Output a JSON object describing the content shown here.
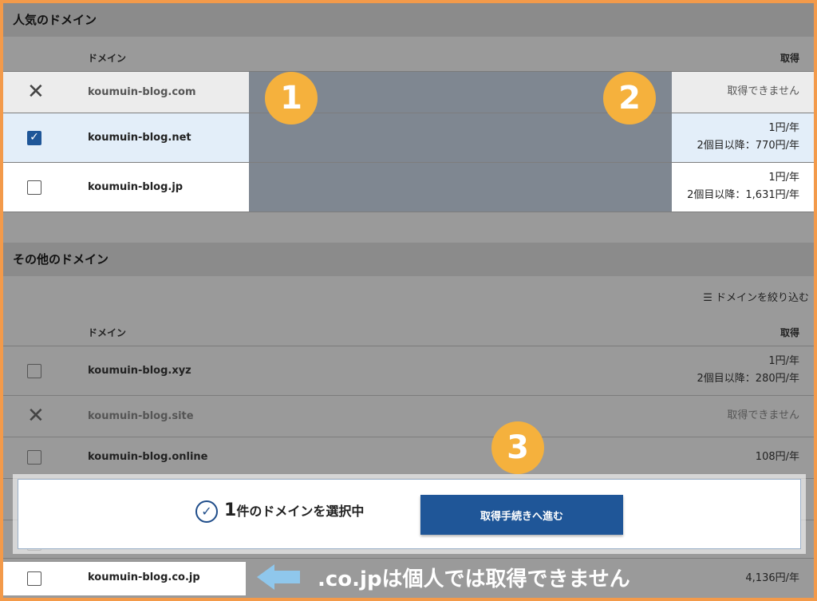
{
  "popular": {
    "title": "人気のドメイン",
    "col_domain": "ドメイン",
    "col_get": "取得",
    "rows": [
      {
        "name": "koumuin-blog.com",
        "price1": "取得できません",
        "price2": "",
        "state": "unavailable"
      },
      {
        "name": "koumuin-blog.net",
        "price1": "1円/年",
        "price2": "2個目以降：770円/年",
        "state": "checked"
      },
      {
        "name": "koumuin-blog.jp",
        "price1": "1円/年",
        "price2": "2個目以降：1,631円/年",
        "state": "unchecked"
      }
    ]
  },
  "other": {
    "title": "その他のドメイン",
    "filter": "ドメインを絞り込む",
    "col_domain": "ドメイン",
    "col_get": "取得",
    "rows": [
      {
        "name": "koumuin-blog.xyz",
        "price1": "1円/年",
        "price2": "2個目以降：280円/年",
        "state": "unchecked"
      },
      {
        "name": "koumuin-blog.site",
        "price1": "取得できません",
        "price2": "",
        "state": "unavailable"
      },
      {
        "name": "koumuin-blog.online",
        "price1": "108円/年",
        "price2": "",
        "state": "unchecked"
      },
      {
        "name": "koumuin-blog.co.jp",
        "price1": "4,136円/年",
        "price2": "",
        "state": "unchecked"
      }
    ]
  },
  "badges": [
    "1",
    "2",
    "3"
  ],
  "bottom_bar": {
    "count": "1",
    "selected_text": "件のドメインを選択中",
    "proceed": "取得手続きへ進む"
  },
  "note": ".co.jpは個人では取得できません",
  "colors": {
    "accent": "#f5b13d",
    "primary": "#1f5698",
    "frame": "#f39a4a",
    "arrow": "#8fc7ec"
  }
}
